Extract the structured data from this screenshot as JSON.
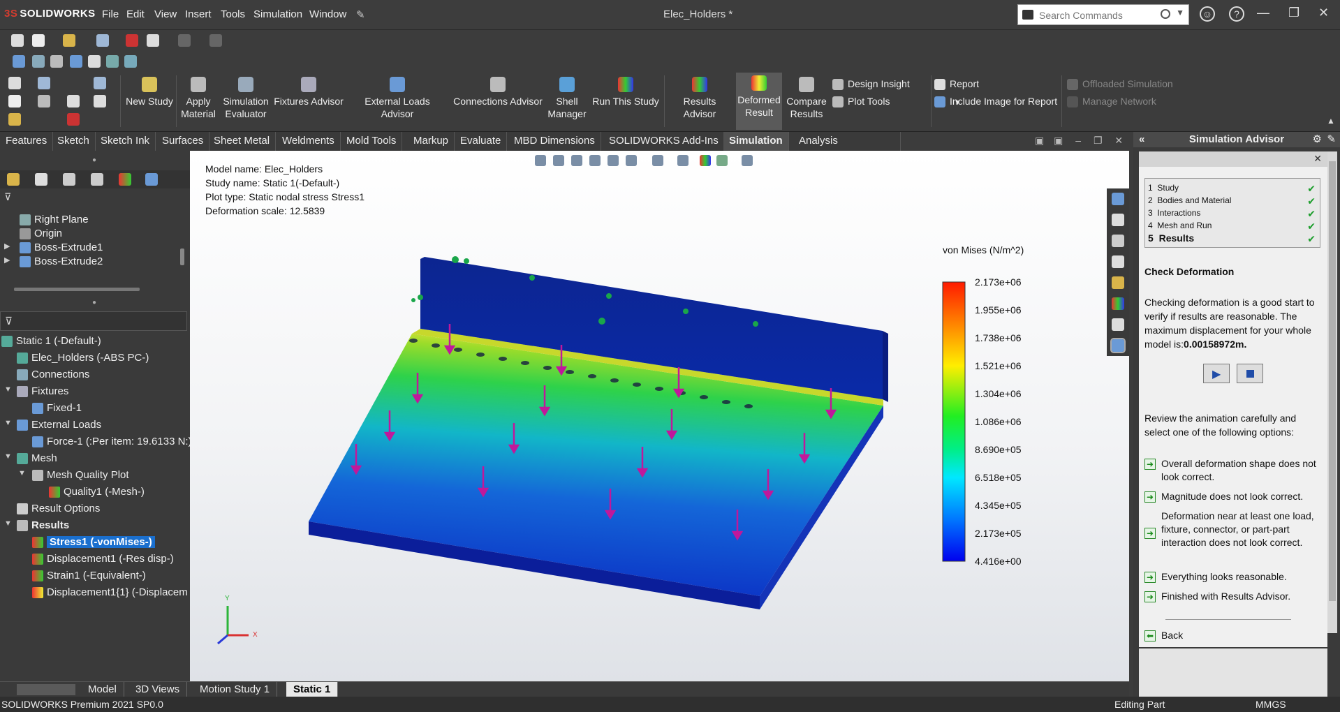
{
  "app": {
    "logo": "SOLIDWORKS",
    "title": "Elec_Holders *"
  },
  "menu": [
    "File",
    "Edit",
    "View",
    "Insert",
    "Tools",
    "Simulation",
    "Window"
  ],
  "search": {
    "placeholder": "Search Commands"
  },
  "command_manager": {
    "buttons": [
      {
        "label": "New Study"
      },
      {
        "label": "Apply\nMaterial"
      },
      {
        "label": "Simulation\nEvaluator"
      },
      {
        "label": "Fixtures Advisor"
      },
      {
        "label": "External Loads Advisor"
      },
      {
        "label": "Connections Advisor"
      },
      {
        "label": "Shell\nManager"
      },
      {
        "label": "Run This Study"
      },
      {
        "label": "Results Advisor"
      },
      {
        "label": "Deformed\nResult"
      },
      {
        "label": "Compare\nResults"
      }
    ],
    "design_insight": "Design Insight",
    "plot_tools": "Plot Tools",
    "report": "Report",
    "include_image": "Include Image for Report",
    "offloaded": "Offloaded Simulation",
    "manage_network": "Manage Network"
  },
  "tabs": [
    "Features",
    "Sketch",
    "Sketch Ink",
    "Surfaces",
    "Sheet Metal",
    "Weldments",
    "Mold Tools",
    "Markup",
    "Evaluate",
    "MBD Dimensions",
    "SOLIDWORKS Add-Ins",
    "Simulation",
    "Analysis Preparation"
  ],
  "feature_tree": [
    "Right Plane",
    "Origin",
    "Boss-Extrude1",
    "Boss-Extrude2"
  ],
  "sim_tree": {
    "study": "Static 1 (-Default-)",
    "part": "Elec_Holders (-ABS PC-)",
    "connections": "Connections",
    "fixtures": "Fixtures",
    "fixed": "Fixed-1",
    "external_loads": "External Loads",
    "force": "Force-1 (:Per item: 19.6133 N:)",
    "mesh": "Mesh",
    "mesh_quality_plot": "Mesh Quality Plot",
    "quality": "Quality1 (-Mesh-)",
    "result_options": "Result Options",
    "results": "Results",
    "stress": "Stress1 (-vonMises-)",
    "displacement": "Displacement1 (-Res disp-)",
    "strain": "Strain1 (-Equivalent-)",
    "displacement2": "Displacement1{1} (-Displacem"
  },
  "plot_info": {
    "model": "Model name: Elec_Holders",
    "study": "Study name: Static 1(-Default-)",
    "plot_type": "Plot type: Static nodal stress Stress1",
    "scale": "Deformation scale: 12.5839"
  },
  "legend": {
    "title": "von Mises (N/m^2)",
    "ticks": [
      "2.173e+06",
      "1.955e+06",
      "1.738e+06",
      "1.521e+06",
      "1.304e+06",
      "1.086e+06",
      "8.690e+05",
      "6.518e+05",
      "4.345e+05",
      "2.173e+05",
      "4.416e+00"
    ]
  },
  "triad": {
    "x": "X",
    "y": "Y"
  },
  "advisor": {
    "header": "Simulation Advisor",
    "steps": [
      {
        "num": "1",
        "label": "Study"
      },
      {
        "num": "2",
        "label": "Bodies and Material"
      },
      {
        "num": "3",
        "label": "Interactions"
      },
      {
        "num": "4",
        "label": "Mesh and Run"
      },
      {
        "num": "5",
        "label": "Results"
      }
    ],
    "section_title": "Check Deformation",
    "description": "Checking deformation is a good start to verify if results are reasonable. The maximum displacement for your whole model is:",
    "max_disp": "0.00158972m.",
    "review": "Review the animation carefully and select one of the following options:",
    "options": [
      "Overall deformation shape does not look correct.",
      "Magnitude does not look correct.",
      "Deformation near at least one load, fixture, connector, or part-part interaction does not look correct.",
      "Everything looks reasonable.",
      "Finished with Results Advisor."
    ],
    "back": "Back"
  },
  "bottom_tabs": [
    "Model",
    "3D Views",
    "Motion Study 1",
    "Static 1"
  ],
  "status": {
    "left": "SOLIDWORKS Premium 2021 SP0.0",
    "mode": "Editing Part",
    "units": "MMGS"
  },
  "colors": {
    "accent": "#1a6fce",
    "brand": "#d63c2f"
  }
}
